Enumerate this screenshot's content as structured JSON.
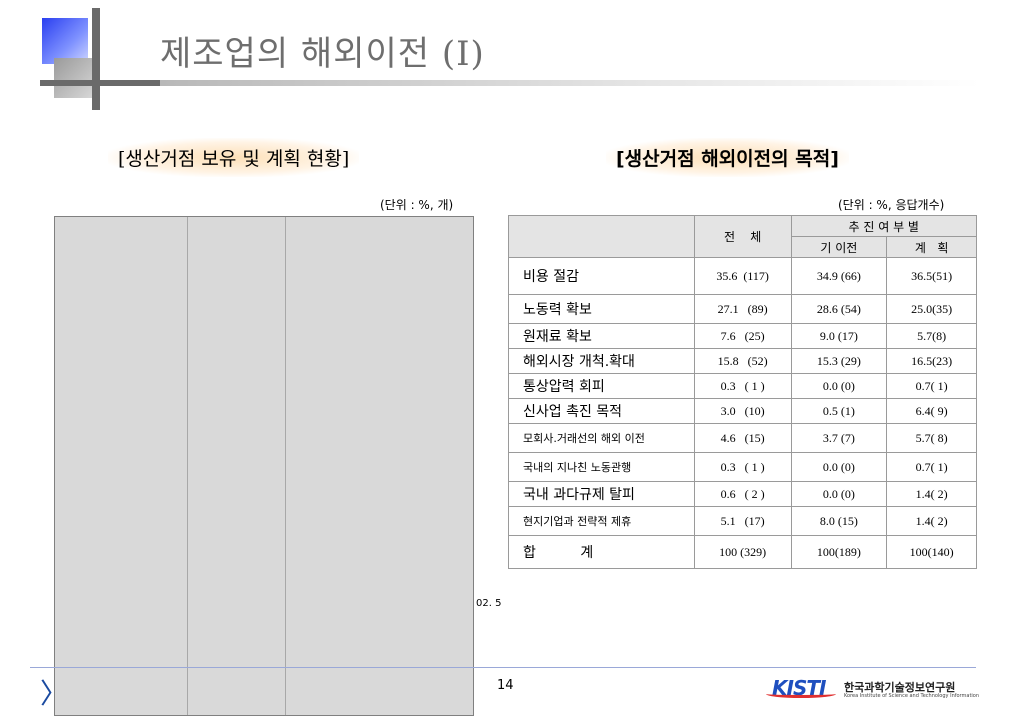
{
  "slide": {
    "title": "제조업의 해외이전 (I)",
    "page_number": "14"
  },
  "left_panel": {
    "section_title": "[생산거점 보유 및 계획 현황]",
    "unit": "(단위 : %, 개)",
    "source_fragment": "02. 5"
  },
  "right_panel": {
    "section_title": "[생산거점 해외이전의 목적]",
    "unit": "(단위 : %, 응답개수)",
    "headers": {
      "total": "전    체",
      "group": "추 진 여 부 별",
      "done": "기 이전",
      "plan": "계   획"
    },
    "rows": [
      {
        "label": "비용 절감",
        "total": "35.6  (117)",
        "done": "34.9 (66)",
        "plan": "36.5(51)"
      },
      {
        "label": "노동력 확보",
        "total": "27.1   (89)",
        "done": "28.6 (54)",
        "plan": "25.0(35)"
      },
      {
        "label": "원재료 확보",
        "total": "7.6   (25)",
        "done": "9.0 (17)",
        "plan": "5.7(8)"
      },
      {
        "label": "해외시장 개척.확대",
        "total": "15.8   (52)",
        "done": "15.3 (29)",
        "plan": "16.5(23)"
      },
      {
        "label": "통상압력 회피",
        "total": "0.3   ( 1 )",
        "done": "0.0 (0)",
        "plan": "0.7( 1)"
      },
      {
        "label": "신사업 촉진 목적",
        "total": "3.0   (10)",
        "done": "0.5 (1)",
        "plan": "6.4( 9)"
      },
      {
        "label": "모회사.거래선의 해외 이전",
        "total": "4.6   (15)",
        "done": "3.7 (7)",
        "plan": "5.7( 8)"
      },
      {
        "label": "국내의 지나친 노동관행",
        "total": "0.3   ( 1 )",
        "done": "0.0 (0)",
        "plan": "0.7( 1)"
      },
      {
        "label": "국내 과다규제 탈피",
        "total": "0.6   ( 2 )",
        "done": "0.0 (0)",
        "plan": "1.4( 2)"
      },
      {
        "label": "현지기업과 전략적 제휴",
        "total": "5.1   (17)",
        "done": "8.0 (15)",
        "plan": "1.4( 2)"
      },
      {
        "label": "합          계",
        "total": "100 (329)",
        "done": "100(189)",
        "plan": "100(140)"
      }
    ]
  },
  "footer": {
    "org_name": "한국과학기술정보연구원",
    "org_sub": "Korea Institute of Science and Technology Information",
    "logo_text": "KISTI"
  }
}
